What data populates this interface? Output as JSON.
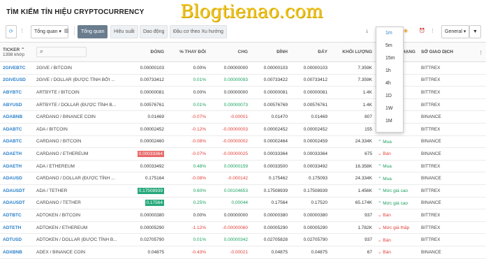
{
  "page_title": "TÌM KIẾM TÍN HIỆU CRYPTOCURRENCY",
  "watermark": "Blogtienao.com",
  "toolbar": {
    "overview_select": "Tổng quan",
    "tabs": [
      "Tổng quan",
      "Hiệu suất",
      "Dao động",
      "Đầu cơ theo Xu hướng"
    ],
    "interval_select": "General"
  },
  "interval_dropdown": [
    "1m",
    "5m",
    "15m",
    "1h",
    "4h",
    "1D",
    "1W",
    "1M"
  ],
  "columns": [
    "TICKER",
    "ĐÓNG",
    "% THAY ĐỔI",
    "CHG",
    "ĐỈNH",
    "ĐÁY",
    "KHỐI LƯỢNG",
    "XẾP HẠNG",
    "SỞ GIAO DỊCH"
  ],
  "ticker_count": "1398 khớp",
  "rows": [
    {
      "ticker": "2GIVEBTC",
      "desc": "2GIVE / BITCOIN",
      "close": "0.00000103",
      "chgp": "0.00%",
      "chg": "0.00000000",
      "high": "0.00000103",
      "low": "0.00000103",
      "vol": "7.359K",
      "sig": "",
      "exch": "BITTREX",
      "dir": "zero",
      "hl": ""
    },
    {
      "ticker": "2GIVEUSD",
      "desc": "2GIVE / DOLLAR (ĐƯỢC TÍNH BỞI ...",
      "close": "0.00733412",
      "chgp": "0.01%",
      "chg": "0.00000093",
      "high": "0.00733422",
      "low": "0.00733412",
      "vol": "7.359K",
      "sig": "",
      "exch": "BITTREX",
      "dir": "pos",
      "hl": ""
    },
    {
      "ticker": "ABYBTC",
      "desc": "ARTBYTE / BITCOIN",
      "close": "0.00000081",
      "chgp": "0.00%",
      "chg": "0.00000000",
      "high": "0.00000081",
      "low": "0.00000081",
      "vol": "1.4K",
      "sig": "",
      "exch": "BITTREX",
      "dir": "zero",
      "hl": ""
    },
    {
      "ticker": "ABYUSD",
      "desc": "ARTBYTE / DOLLAR (ĐƯỢC TÍNH B...",
      "close": "0.00576761",
      "chgp": "0.01%",
      "chg": "0.00000073",
      "high": "0.00576769",
      "low": "0.00576761",
      "vol": "1.4K",
      "sig": "",
      "exch": "BITTREX",
      "dir": "pos",
      "hl": ""
    },
    {
      "ticker": "ADABNB",
      "desc": "CARDANO / BINANCE COIN",
      "close": "0.01469",
      "chgp": "-0.07%",
      "chg": "-0.00001",
      "high": "0.01470",
      "low": "0.01469",
      "vol": "807",
      "sig": "",
      "exch": "BINANCE",
      "dir": "neg",
      "hl": ""
    },
    {
      "ticker": "ADABTC",
      "desc": "ADA / BITCOIN",
      "close": "0.00002452",
      "chgp": "-0.12%",
      "chg": "-0.00000003",
      "high": "0.00002452",
      "low": "0.00002452",
      "vol": "155",
      "sig": "",
      "exch": "BITTREX",
      "dir": "neg",
      "hl": ""
    },
    {
      "ticker": "ADABTC",
      "desc": "CARDANO / BITCOIN",
      "close": "0.00002460",
      "chgp": "-0.08%",
      "chg": "-0.00000002",
      "high": "0.00002464",
      "low": "0.00002459",
      "vol": "24.334K",
      "sig": "Mua",
      "exch": "BINANCE",
      "dir": "neg",
      "hl": ""
    },
    {
      "ticker": "ADAETH",
      "desc": "CARDANO / ETHEREUM",
      "close": "0.00033364",
      "chgp": "-0.07%",
      "chg": "-0.00000025",
      "high": "0.00033364",
      "low": "0.00033364",
      "vol": "675",
      "sig": "Bán",
      "exch": "BINANCE",
      "dir": "neg",
      "hl": "red"
    },
    {
      "ticker": "ADAETH",
      "desc": "ADA / ETHEREUM",
      "close": "0.00033492",
      "chgp": "0.48%",
      "chg": "0.00000159",
      "high": "0.00033500",
      "low": "0.00033492",
      "vol": "16.358K",
      "sig": "Mua",
      "exch": "BITTREX",
      "dir": "pos",
      "hl": ""
    },
    {
      "ticker": "ADAUSD",
      "desc": "CARDANO / DOLLAR (ĐƯỢC TÍNH ...",
      "close": "0.175164",
      "chgp": "-0.08%",
      "chg": "-0.000142",
      "high": "0.175462",
      "low": "0.175093",
      "vol": "24.334K",
      "sig": "Mua",
      "exch": "BINANCE",
      "dir": "neg",
      "hl": ""
    },
    {
      "ticker": "ADAUSDT",
      "desc": "ADA / TETHER",
      "close": "0.17508939",
      "chgp": "0.60%",
      "chg": "0.00104653",
      "high": "0.17508939",
      "low": "0.17508939",
      "vol": "1.456K",
      "sig": "Mức giá cao",
      "exch": "BITTREX",
      "dir": "pos",
      "hl": "green"
    },
    {
      "ticker": "ADAUSDT",
      "desc": "CARDANO / TETHER",
      "close": "0.17564",
      "chgp": "0.25%",
      "chg": "0.00044",
      "high": "0.17564",
      "low": "0.17520",
      "vol": "65.174K",
      "sig": "Mức giá cao",
      "exch": "BINANCE",
      "dir": "pos",
      "hl": "green"
    },
    {
      "ticker": "ADTBTC",
      "desc": "ADTOKEN / BITCOIN",
      "close": "0.00000380",
      "chgp": "0.00%",
      "chg": "0.00000000",
      "high": "0.00000380",
      "low": "0.00000380",
      "vol": "937",
      "sig": "Bán",
      "exch": "BITTREX",
      "dir": "zero",
      "hl": ""
    },
    {
      "ticker": "ADTETH",
      "desc": "ADTOKEN / ETHEREUM",
      "close": "0.00005290",
      "chgp": "-1.12%",
      "chg": "-0.00000060",
      "high": "0.00005290",
      "low": "0.00005290",
      "vol": "1.782K",
      "sig": "Mức giá thấp",
      "exch": "BITTREX",
      "dir": "neg",
      "hl": ""
    },
    {
      "ticker": "ADTUSD",
      "desc": "ADTOKEN / DOLLAR (ĐƯỢC TÍNH B...",
      "close": "0.02705790",
      "chgp": "0.01%",
      "chg": "0.00000342",
      "high": "0.02705828",
      "low": "0.02705790",
      "vol": "937",
      "sig": "Bán",
      "exch": "BITTREX",
      "dir": "pos",
      "hl": ""
    },
    {
      "ticker": "ADXBNB",
      "desc": "ADEX / BINANCE COIN",
      "close": "0.04875",
      "chgp": "-0.43%",
      "chg": "-0.00021",
      "high": "0.04875",
      "low": "0.04875",
      "vol": "67",
      "sig": "Bán",
      "exch": "BINANCE",
      "dir": "neg",
      "hl": ""
    }
  ],
  "colors": {
    "accent": "#2a7fc9",
    "positive": "#1aa260",
    "negative": "#e0413a",
    "highlight_red": "#e86a6a",
    "highlight_green": "#26a87a"
  }
}
